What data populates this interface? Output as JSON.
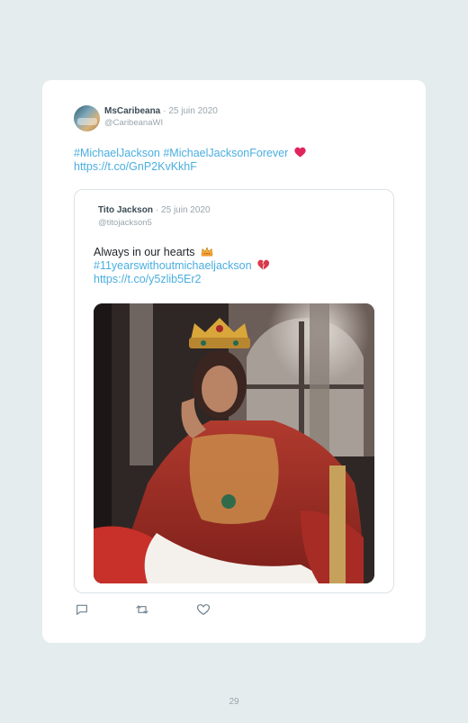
{
  "tweet": {
    "author_name": "MsCaribeana",
    "date": "· 25 juin 2020",
    "handle": "@CaribeanaWI",
    "hashtags": "#MichaelJackson #MichaelJacksonForever",
    "link": "https://t.co/GnP2KvKkhF"
  },
  "quoted_tweet": {
    "author_name": "Tito Jackson",
    "date": "· 25 juin 2020",
    "handle": "@titojackson5",
    "text": "Always in our hearts",
    "hashtag": "#11yearswithoutmichaeljackson",
    "link": "https://t.co/y5zlib5Er2"
  },
  "icons": {
    "heart_emoji": "red-heart-icon",
    "crown_emoji": "crown-icon",
    "broken_heart_emoji": "broken-heart-icon",
    "reply": "reply-icon",
    "retweet": "retweet-icon",
    "like": "like-icon"
  },
  "colors": {
    "link": "#4aaee0",
    "heart": "#e0245e",
    "background": "#e5ecee"
  },
  "page": {
    "number": "29"
  }
}
